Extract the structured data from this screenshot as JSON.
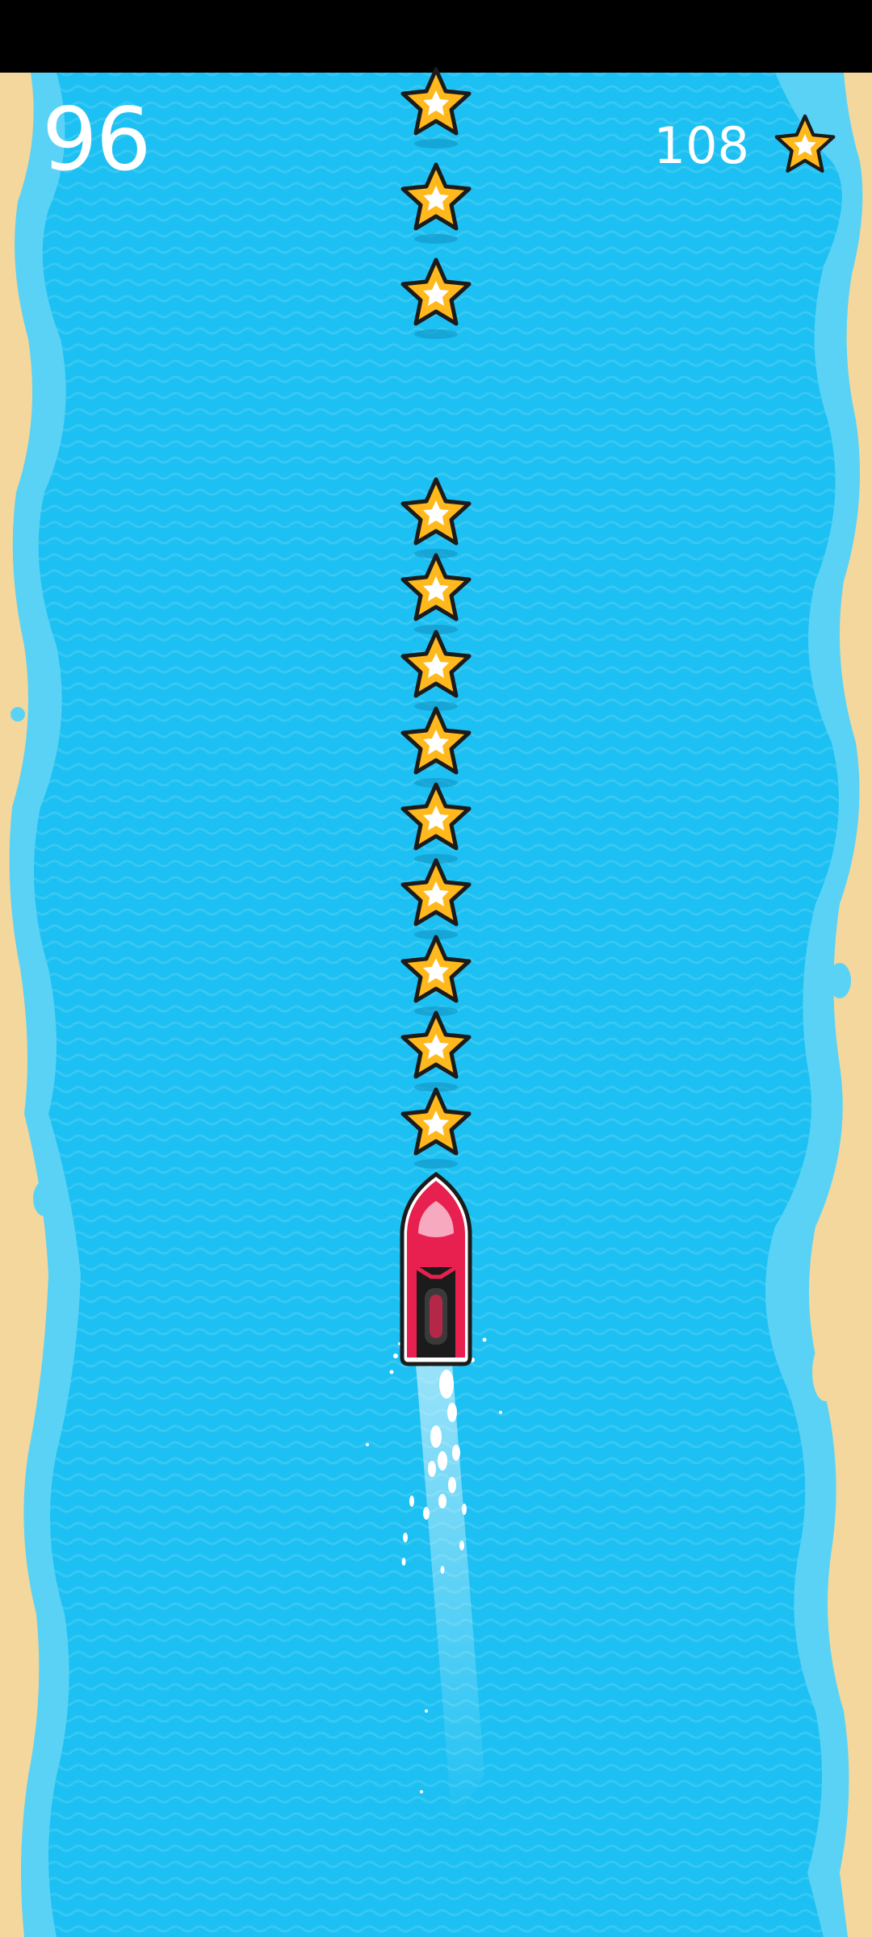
{
  "hud": {
    "score": "96",
    "stars_collected": "108",
    "stars_icon": "star-icon"
  },
  "game": {
    "player": "red-jet-ski",
    "collectible": "star",
    "collectibles_visible": 12,
    "colors": {
      "water": "#1dc0f3",
      "water_light": "#3fd0f8",
      "sand": "#f4d79c",
      "shore_foam": "#7ed8f5",
      "star_fill": "#ffb91c",
      "star_outline": "#1b1b1b",
      "boat_red": "#e8204f",
      "status_bar": "#000000"
    }
  }
}
